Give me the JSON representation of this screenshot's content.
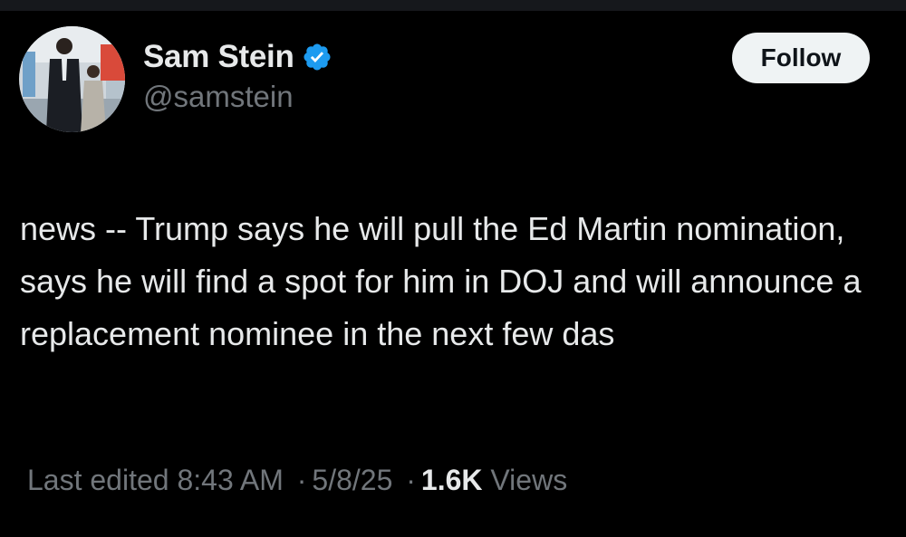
{
  "author": {
    "display_name": "Sam Stein",
    "handle": "@samstein",
    "verified": true,
    "verified_color": "#1d9bf0",
    "avatar_icon": "profile-photo"
  },
  "follow_button": {
    "label": "Follow"
  },
  "tweet": {
    "text": "news -- Trump says he will pull the Ed Martin nomination, says he will find a spot for him in DOJ and will announce a replacement nominee in the next few das"
  },
  "meta": {
    "edited_label": "Last edited 8:43 AM",
    "separator": "·",
    "date": "5/8/25",
    "views_count": "1.6K",
    "views_label": "Views"
  },
  "colors": {
    "background": "#000000",
    "text_primary": "#e7e9ea",
    "text_secondary": "#71767b",
    "button_bg": "#eff3f4"
  }
}
